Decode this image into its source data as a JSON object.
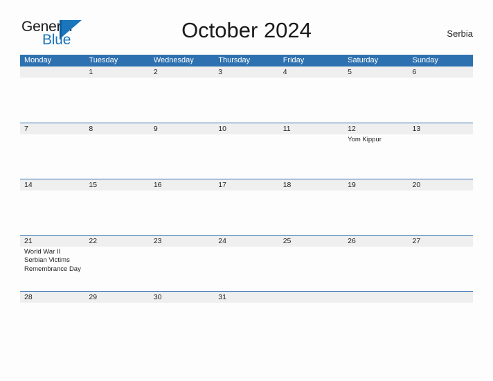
{
  "brand": {
    "name_part1": "General",
    "name_part2": "Blue",
    "mark_icon": "flag-triangle-icon"
  },
  "header": {
    "title": "October 2024",
    "region": "Serbia"
  },
  "calendar": {
    "weekdays": [
      "Monday",
      "Tuesday",
      "Wednesday",
      "Thursday",
      "Friday",
      "Saturday",
      "Sunday"
    ],
    "colors": {
      "header_blue": "#2e71b0",
      "row_band_gray": "#efefef",
      "page_background": "#fdfdfd",
      "text": "#222222",
      "brand_blue": "#1b75bb"
    },
    "weeks": [
      {
        "days": [
          {
            "num": "",
            "events": []
          },
          {
            "num": "1",
            "events": []
          },
          {
            "num": "2",
            "events": []
          },
          {
            "num": "3",
            "events": []
          },
          {
            "num": "4",
            "events": []
          },
          {
            "num": "5",
            "events": []
          },
          {
            "num": "6",
            "events": []
          }
        ]
      },
      {
        "days": [
          {
            "num": "7",
            "events": []
          },
          {
            "num": "8",
            "events": []
          },
          {
            "num": "9",
            "events": []
          },
          {
            "num": "10",
            "events": []
          },
          {
            "num": "11",
            "events": []
          },
          {
            "num": "12",
            "events": [
              "Yom Kippur"
            ]
          },
          {
            "num": "13",
            "events": []
          }
        ]
      },
      {
        "days": [
          {
            "num": "14",
            "events": []
          },
          {
            "num": "15",
            "events": []
          },
          {
            "num": "16",
            "events": []
          },
          {
            "num": "17",
            "events": []
          },
          {
            "num": "18",
            "events": []
          },
          {
            "num": "19",
            "events": []
          },
          {
            "num": "20",
            "events": []
          }
        ]
      },
      {
        "days": [
          {
            "num": "21",
            "events": [
              "World War II",
              "Serbian Victims",
              "Remembrance Day"
            ]
          },
          {
            "num": "22",
            "events": []
          },
          {
            "num": "23",
            "events": []
          },
          {
            "num": "24",
            "events": []
          },
          {
            "num": "25",
            "events": []
          },
          {
            "num": "26",
            "events": []
          },
          {
            "num": "27",
            "events": []
          }
        ]
      },
      {
        "days": [
          {
            "num": "28",
            "events": []
          },
          {
            "num": "29",
            "events": []
          },
          {
            "num": "30",
            "events": []
          },
          {
            "num": "31",
            "events": []
          },
          {
            "num": "",
            "events": []
          },
          {
            "num": "",
            "events": []
          },
          {
            "num": "",
            "events": []
          }
        ]
      }
    ]
  }
}
